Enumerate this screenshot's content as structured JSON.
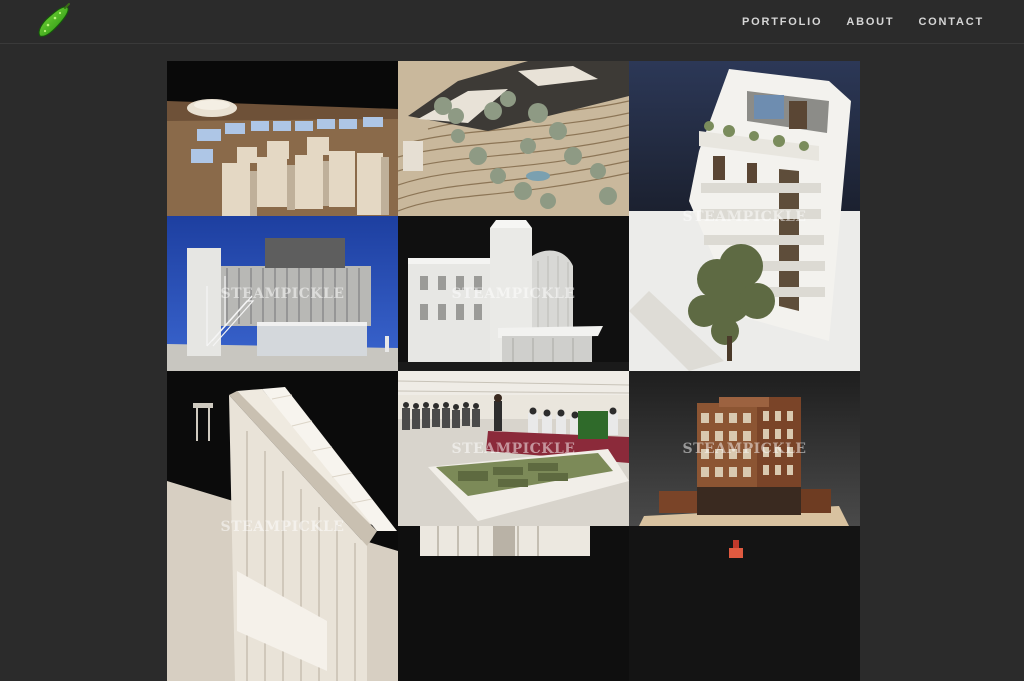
{
  "site": {
    "logo_icon": "pickle-icon"
  },
  "nav": {
    "items": [
      "PORTFOLIO",
      "ABOUT",
      "CONTACT"
    ]
  },
  "gallery": {
    "watermark": "STEAMPICKLE",
    "tiles": [
      {
        "name": "masterplan-model",
        "subject": "urban masterplan model with stadium",
        "show_watermark": false
      },
      {
        "name": "terraced-landscape-model",
        "subject": "terraced landscape model with trees",
        "show_watermark": false
      },
      {
        "name": "tower-model",
        "subject": "white residential tower model with tree",
        "show_watermark": true
      },
      {
        "name": "pavilion-model",
        "subject": "pavilion with external stair on blue",
        "show_watermark": true
      },
      {
        "name": "historic-facade-model",
        "subject": "historic building with canopy",
        "show_watermark": true
      },
      {
        "name": "ramp-building-model",
        "subject": "white building with sloped roof",
        "show_watermark": true
      },
      {
        "name": "presentation-event-photo",
        "subject": "audience at model presentation under tent",
        "show_watermark": true
      },
      {
        "name": "brick-building-model",
        "subject": "brick apartment block model",
        "show_watermark": true
      },
      {
        "name": "partial-row-model-a",
        "subject": "cropped model photo",
        "show_watermark": false
      },
      {
        "name": "partial-row-model-b",
        "subject": "cropped model photo",
        "show_watermark": false
      }
    ]
  }
}
